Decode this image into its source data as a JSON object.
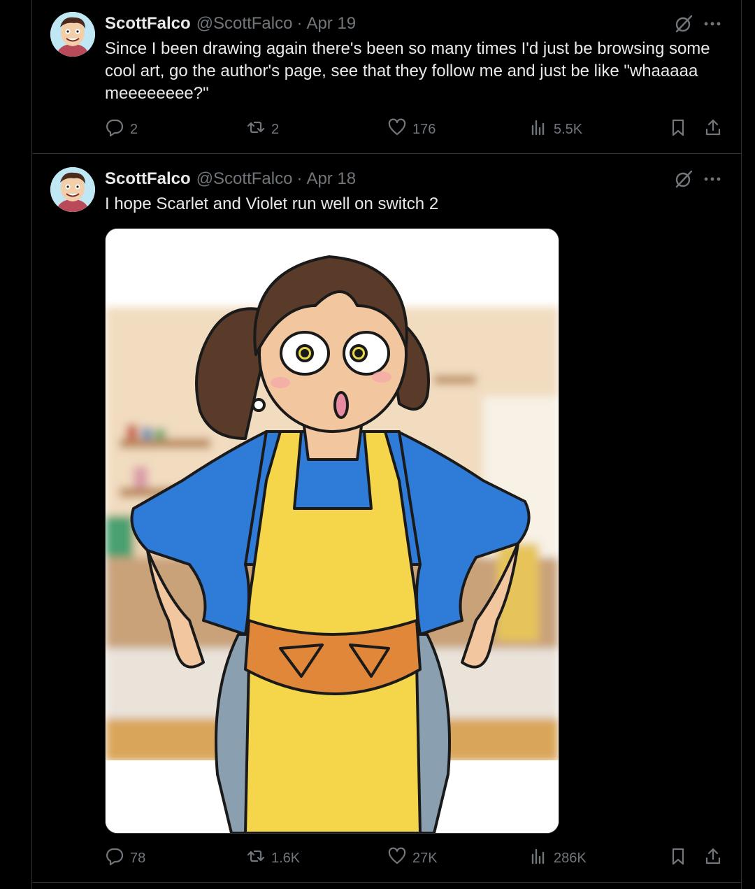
{
  "posts": [
    {
      "author": {
        "name": "ScottFalco",
        "handle": "@ScottFalco"
      },
      "date": "Apr 19",
      "text": "Since I been drawing again there's been so many times I'd just be browsing some cool art, go the author's page, see that they follow me and just be like \"whaaaaa meeeeeeee?\"",
      "metrics": {
        "replies": "2",
        "reposts": "2",
        "likes": "176",
        "views": "5.5K"
      }
    },
    {
      "author": {
        "name": "ScottFalco",
        "handle": "@ScottFalco"
      },
      "date": "Apr 18",
      "text": "I hope Scarlet and Violet run well on switch 2",
      "metrics": {
        "replies": "78",
        "reposts": "1.6K",
        "likes": "27K",
        "views": "286K"
      }
    }
  ],
  "separator": "·",
  "icons": {
    "reply": "reply-icon",
    "repost": "repost-icon",
    "like": "heart-icon",
    "views": "analytics-icon",
    "bookmark": "bookmark-icon",
    "share": "share-icon",
    "grok": "grok-icon",
    "more": "more-icon"
  },
  "colors": {
    "background": "#000000",
    "text": "#e7e9ea",
    "secondary": "#71767b",
    "border": "#2f3336"
  }
}
